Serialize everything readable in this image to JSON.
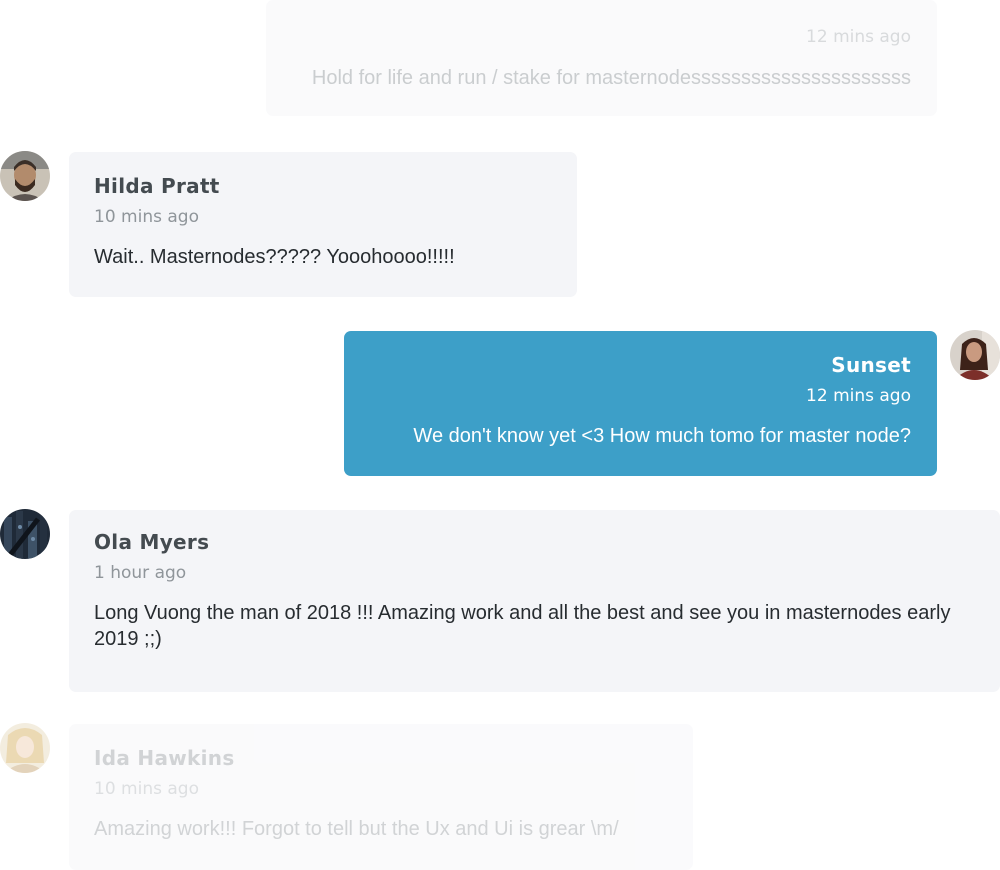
{
  "messages": [
    {
      "time": "12 mins ago",
      "text": "Hold for life and run / stake for masternodessssssssssssssssssssss"
    },
    {
      "name": "Hilda Pratt",
      "time": "10 mins ago",
      "text": "Wait.. Masternodes????? Yooohoooo!!!!!",
      "avatar": "man-with-beard-avatar"
    },
    {
      "name": "Sunset",
      "time": "12 mins ago",
      "text": "We don't know yet <3 How much tomo for master node?",
      "avatar": "woman-portrait-avatar"
    },
    {
      "name": "Ola Myers",
      "time": "1 hour ago",
      "text": "Long Vuong the man of 2018 !!! Amazing work and all the best and see you in masternodes early 2019 ;;)",
      "avatar": "dark-city-avatar"
    },
    {
      "name": "Ida Hawkins",
      "time": "10 mins ago",
      "text": "Amazing work!!! Forgot to tell but the Ux and Ui is grear \\m/",
      "avatar": "light-portrait-avatar"
    }
  ],
  "colors": {
    "bubble": "#f4f5f8",
    "mine_bubble": "#3d9fc8",
    "name": "#444b50",
    "time": "#8f959a",
    "text": "#272c30"
  }
}
